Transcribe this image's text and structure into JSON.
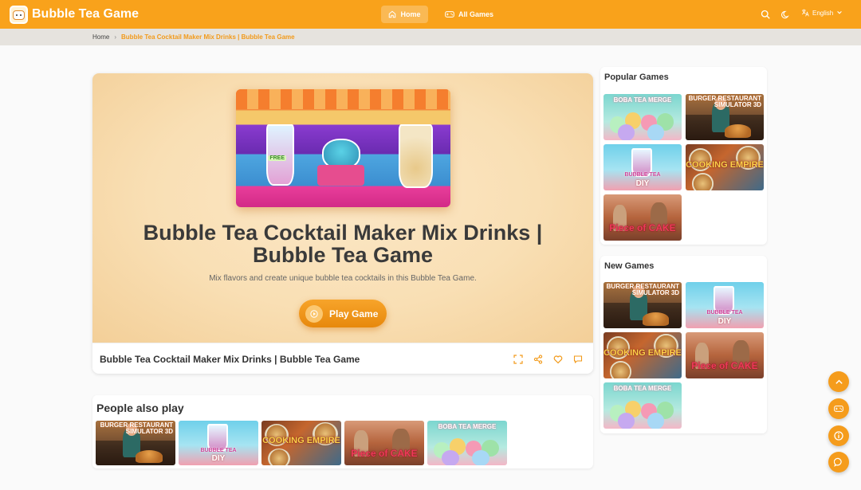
{
  "header": {
    "brand": "Bubble Tea Game",
    "nav": [
      {
        "label": "Home",
        "active": true
      },
      {
        "label": "All Games",
        "active": false
      }
    ],
    "language": "English"
  },
  "breadcrumb": {
    "home": "Home",
    "separator": "›",
    "current": "Bubble Tea Cocktail Maker Mix Drinks | Bubble Tea Game"
  },
  "game": {
    "title": "Bubble Tea Cocktail Maker Mix Drinks | Bubble Tea Game",
    "description": "Mix flavors and create unique bubble tea cocktails in this Bubble Tea Game.",
    "play_label": "Play Game",
    "footer_title": "Bubble Tea Cocktail Maker Mix Drinks | Bubble Tea Game",
    "thumb_free": "FREE"
  },
  "people_also_play": {
    "title": "People also play",
    "items": [
      {
        "art": "burger",
        "caption": "BURGER RESTAURANT SIMULATOR 3D"
      },
      {
        "art": "diy",
        "caption_top": "BUBBLE TEA",
        "caption_bottom": "DIY"
      },
      {
        "art": "cook",
        "caption": "COOKING EMPIRE"
      },
      {
        "art": "cake",
        "caption_a": "Piece",
        "caption_b": "of",
        "caption_c": "CAKE"
      },
      {
        "art": "boba",
        "caption": "BOBA TEA MERGE"
      }
    ]
  },
  "popular_games": {
    "title": "Popular Games",
    "items": [
      {
        "art": "boba",
        "caption": "BOBA TEA MERGE"
      },
      {
        "art": "burger",
        "caption": "BURGER RESTAURANT SIMULATOR 3D"
      },
      {
        "art": "diy",
        "caption_top": "BUBBLE TEA",
        "caption_bottom": "DIY"
      },
      {
        "art": "cook",
        "caption": "COOKING EMPIRE"
      },
      {
        "art": "cake",
        "caption_a": "Piece",
        "caption_b": "of",
        "caption_c": "CAKE"
      }
    ]
  },
  "new_games": {
    "title": "New Games",
    "items": [
      {
        "art": "burger",
        "caption": "BURGER RESTAURANT SIMULATOR 3D"
      },
      {
        "art": "diy",
        "caption_top": "BUBBLE TEA",
        "caption_bottom": "DIY"
      },
      {
        "art": "cook",
        "caption": "COOKING EMPIRE"
      },
      {
        "art": "cake",
        "caption_a": "Piece",
        "caption_b": "of",
        "caption_c": "CAKE"
      },
      {
        "art": "boba",
        "caption": "BOBA TEA MERGE"
      }
    ]
  },
  "colors": {
    "accent": "#f9a21b",
    "accent_dark": "#e7880c",
    "breadcrumb_current": "#f29a1a"
  },
  "icons": {
    "home": "home-icon",
    "all_games": "gamepad-icon",
    "search": "search-icon",
    "theme": "moon-icon",
    "language": "translate-icon",
    "fullscreen": "fullscreen-icon",
    "share": "share-icon",
    "favorite": "heart-icon",
    "comment": "comment-icon",
    "fab": [
      "arrow-up-icon",
      "gamepad-icon",
      "info-icon",
      "chat-icon"
    ]
  }
}
